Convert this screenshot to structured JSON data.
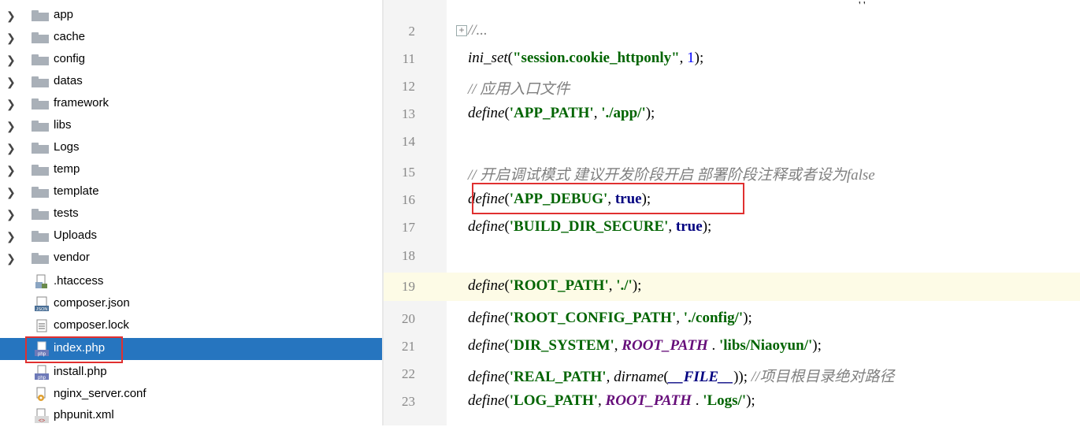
{
  "tree": {
    "folders": [
      "app",
      "cache",
      "config",
      "datas",
      "framework",
      "libs",
      "Logs",
      "temp",
      "template",
      "tests",
      "Uploads",
      "vendor"
    ],
    "files": [
      {
        "name": ".htaccess",
        "icon": "htaccess-icon"
      },
      {
        "name": "composer.json",
        "icon": "json-file-icon"
      },
      {
        "name": "composer.lock",
        "icon": "text-file-icon"
      },
      {
        "name": "index.php",
        "icon": "php-file-icon",
        "selected": true
      },
      {
        "name": "install.php",
        "icon": "php-file-icon"
      },
      {
        "name": "nginx_server.conf",
        "icon": "conf-file-icon"
      },
      {
        "name": "phpunit.xml",
        "icon": "xml-file-icon"
      }
    ],
    "selected_color": "#2675bf"
  },
  "editor": {
    "lines": [
      {
        "n": "2"
      },
      {
        "n": "11"
      },
      {
        "n": "12"
      },
      {
        "n": "13"
      },
      {
        "n": "14"
      },
      {
        "n": "15"
      },
      {
        "n": "16"
      },
      {
        "n": "17"
      },
      {
        "n": "18"
      },
      {
        "n": "19"
      },
      {
        "n": "20"
      },
      {
        "n": "21"
      },
      {
        "n": "22"
      },
      {
        "n": "23"
      }
    ],
    "top_fragment": "' '",
    "fold_glyph": "+",
    "code": {
      "l2_text": "//...",
      "l11_fn": "ini_set",
      "l11_str": "\"session.cookie_httponly\"",
      "l11_num": "1",
      "l12_comment": "// 应用入口文件",
      "l13_fn": "define",
      "l13_a": "'APP_PATH'",
      "l13_b": "'./app/'",
      "l15_comment": "// 开启调试模式 建议开发阶段开启 部署阶段注释或者设为false",
      "l16_fn": "define",
      "l16_a": "'APP_DEBUG'",
      "l16_b": "true",
      "l17_fn": "define",
      "l17_a": "'BUILD_DIR_SECURE'",
      "l17_b": "true",
      "l19_fn": "define",
      "l19_a": "'ROOT_PATH'",
      "l19_b": "'./'",
      "l20_fn": "define",
      "l20_a": "'ROOT_CONFIG_PATH'",
      "l20_b": "'./config/'",
      "l21_fn": "define",
      "l21_a": "'DIR_SYSTEM'",
      "l21_const": "ROOT_PATH",
      "l21_b": "'libs/Niaoyun/'",
      "l22_fn": "define",
      "l22_a": "'REAL_PATH'",
      "l22_fn2": "dirname",
      "l22_magic": "__FILE__",
      "l22_comment": "//项目根目录绝对路径",
      "l23_fn": "define",
      "l23_a": "'LOG_PATH'",
      "l23_const": "ROOT_PATH",
      "l23_b": "'Logs/'"
    }
  }
}
